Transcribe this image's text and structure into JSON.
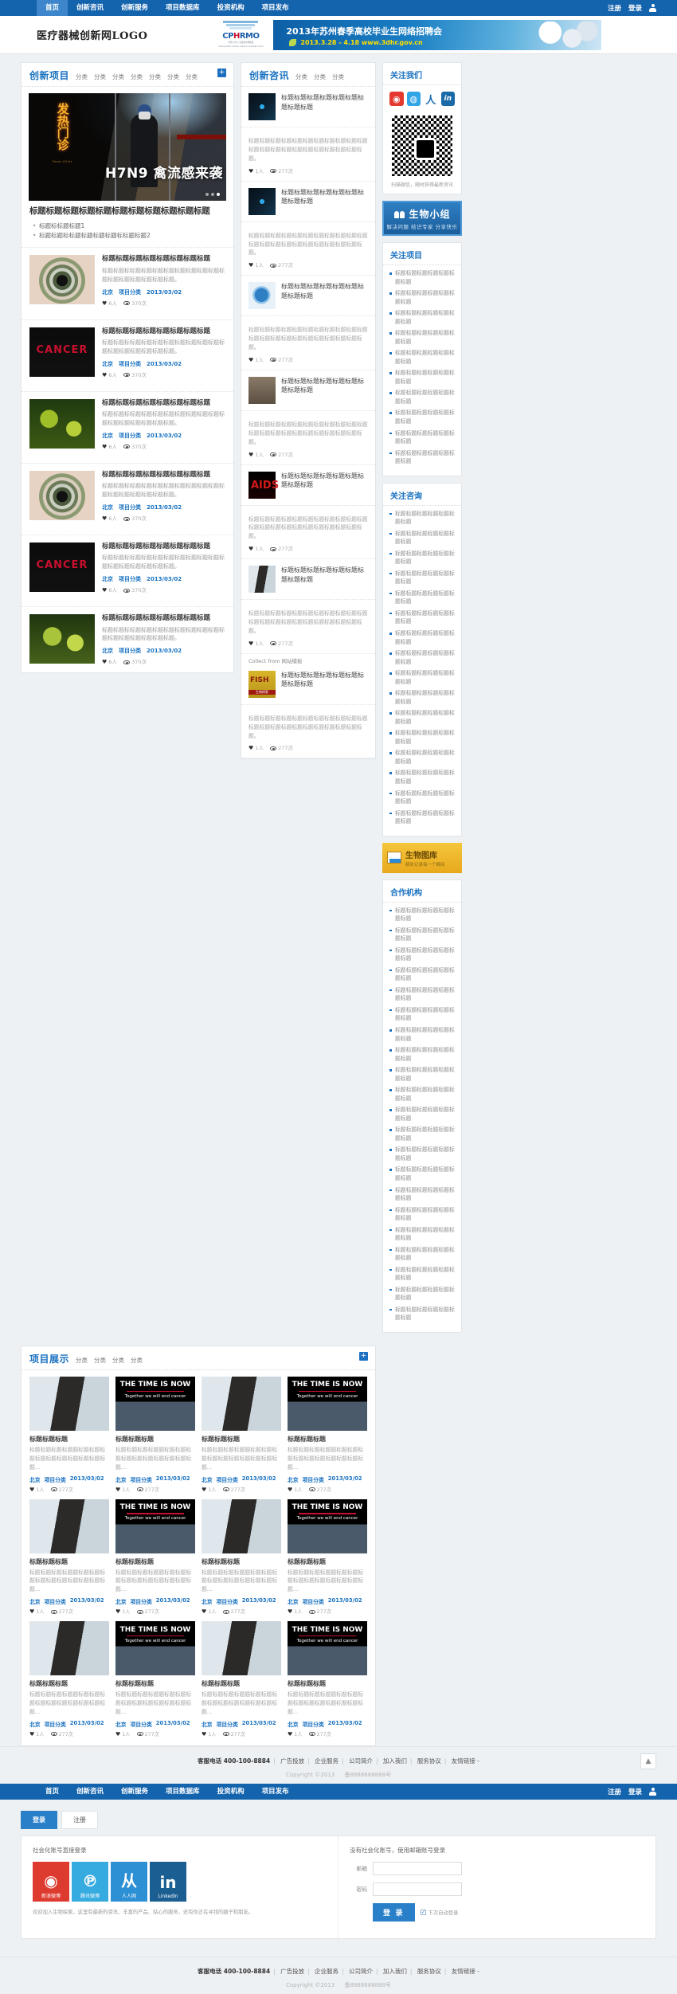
{
  "topnav": {
    "items": [
      "首页",
      "创新咨讯",
      "创新服务",
      "项目数据库",
      "投资机构",
      "项目发布"
    ],
    "active_index": 0,
    "register": "注册",
    "login": "登录"
  },
  "masthead": {
    "logo_text": "医疗器械创新网LOGO",
    "cphrmo": {
      "name_a": "CP",
      "name_b": "H",
      "name_c": "RMO",
      "sub1": "中国·公共人力资源市场联盟",
      "sub2": "China public human resource market union"
    },
    "banner": {
      "title": "2013年苏州春季高校毕业生网络招聘会",
      "subtitle": "2013.3.28 - 4.18 www.3dhr.gov.cn"
    }
  },
  "projects_section": {
    "title": "创新项目",
    "categories": [
      "分类",
      "分类",
      "分类",
      "分类",
      "分类",
      "分类",
      "分类"
    ],
    "plus": "+",
    "hero": {
      "sign_cn": "发热门诊",
      "sign_en": "Fever Clinic",
      "headline": "H7N9 禽流感来袭",
      "slide_count": 3,
      "active_slide": 2
    },
    "lead": {
      "title": "标题标题标题标题标题标题标题标题标题标题标题",
      "bullets": [
        "标题标标题标题1",
        "标题标题标标题标题标题标题标标题标题2"
      ]
    },
    "articles": [
      {
        "title": "标题标题标题标题标题标题标题标题",
        "desc": "标题标题标标题标题标题标题标题标题标题标题标题标题标题标题标题标题标题。",
        "loc": "北京",
        "cat": "项目分类",
        "date": "2013/03/02",
        "likes": "6人",
        "views": "370次",
        "thumb": "eye"
      },
      {
        "title": "标题标题标题标题标题标题标题标题",
        "desc": "标题标题标标题标题标题标题标题标题标题标题标题标题标题标题标题标题标题。",
        "loc": "北京",
        "cat": "项目分类",
        "date": "2013/03/02",
        "likes": "6人",
        "views": "370次",
        "thumb": "cancer"
      },
      {
        "title": "标题标题标题标题标题标题标题标题",
        "desc": "标题标题标标题标题标题标题标题标题标题标题标题标题标题标题标题标题标题。",
        "loc": "北京",
        "cat": "项目分类",
        "date": "2013/03/02",
        "likes": "6人",
        "views": "370次",
        "thumb": "green"
      },
      {
        "title": "标题标题标题标题标题标题标题标题",
        "desc": "标题标题标标题标题标题标题标题标题标题标题标题标题标题标题标题标题标题。",
        "loc": "北京",
        "cat": "项目分类",
        "date": "2013/03/02",
        "likes": "6人",
        "views": "370次",
        "thumb": "eye"
      },
      {
        "title": "标题标题标题标题标题标题标题标题",
        "desc": "标题标题标标题标题标题标题标题标题标题标题标题标题标题标题标题标题标题。",
        "loc": "北京",
        "cat": "项目分类",
        "date": "2013/03/02",
        "likes": "6人",
        "views": "370次",
        "thumb": "cancer2"
      },
      {
        "title": "标题标题标题标题标题标题标题标题",
        "desc": "标题标题标标题标题标题标题标题标题标题标题标题标题标题标题标题标题标题。",
        "loc": "北京",
        "cat": "项目分类",
        "date": "2013/03/02",
        "likes": "6人",
        "views": "370次",
        "thumb": "green2"
      }
    ]
  },
  "news_section": {
    "title": "创新咨讯",
    "categories": [
      "分类",
      "分类",
      "分类"
    ],
    "collect_note": "Collect from 网站模板",
    "items": [
      {
        "title": "标题标题标题标题标题标题标题标题标题",
        "desc": "标题标题标题标题标题标题标题标题标题标题标题标题标题标题标题标题标题标题标题标题标题标题。",
        "likes": "1人",
        "views": "277次",
        "thumb": "dna"
      },
      {
        "title": "标题标题标题标题标题标题标题标题标题",
        "desc": "标题标题标题标题标题标题标题标题标题标题标题标题标题标题标题标题标题标题标题标题标题标题。",
        "likes": "1人",
        "views": "277次",
        "thumb": "dna"
      },
      {
        "title": "标题标题标题标题标题标题标题标题标题",
        "desc": "标题标题标题标题标题标题标题标题标题标题标题标题标题标题标题标题标题标题标题标题标题标题。",
        "likes": "1人",
        "views": "277次",
        "thumb": "globe"
      },
      {
        "title": "标题标题标题标题标题标题标题标题标题",
        "desc": "标题标题标题标题标题标题标题标题标题标题标题标题标题标题标题标题标题标题标题标题标题标题。",
        "likes": "1人",
        "views": "277次",
        "thumb": "man"
      },
      {
        "title": "标题标题标题标题标题标题标题标题标题",
        "desc": "标题标题标题标题标题标题标题标题标题标题标题标题标题标题标题标题标题标题标题标题标题标题。",
        "likes": "1人",
        "views": "277次",
        "thumb": "aids"
      },
      {
        "title": "标题标题标题标题标题标题标题标题标题",
        "desc": "标题标题标题标题标题标题标题标题标题标题标题标题标题标题标题标题标题标题标题标题标题标题。",
        "likes": "1人",
        "views": "277次",
        "thumb": "lab"
      },
      {
        "title": "标题标题标题标题标题标题标题标题标题",
        "desc": "标题标题标题标题标题标题标题标题标题标题标题标题标题标题标题标题标题标题标题标题标题标题。",
        "likes": "1人",
        "views": "277次",
        "thumb": "fish"
      }
    ]
  },
  "sidebar": {
    "follow": {
      "title": "关注我们",
      "socials": [
        "weibo-icon",
        "qq-icon",
        "renren-icon",
        "linkedin-icon"
      ],
      "qr_caption": "扫描微信，随时获得最新资讯"
    },
    "group_banner": {
      "title": "生物小组",
      "subtitle": "解决问题  结识专家  分享快乐"
    },
    "watch_projects": {
      "title": "关注项目",
      "items": [
        "标题标题标题标题标题标题标题",
        "标题标题标题标题标题标题标题",
        "标题标题标题标题标题标题标题",
        "标题标题标题标题标题标题标题",
        "标题标题标题标题标题标题标题",
        "标题标题标题标题标题标题标题",
        "标题标题标题标题标题标题标题",
        "标题标题标题标题标题标题标题",
        "标题标题标题标题标题标题标题",
        "标题标题标题标题标题标题标题"
      ]
    },
    "watch_news": {
      "title": "关注咨询",
      "items": [
        "标题标题标题标题标题标题标题",
        "标题标题标题标题标题标题标题",
        "标题标题标题标题标题标题标题",
        "标题标题标题标题标题标题标题",
        "标题标题标题标题标题标题标题",
        "标题标题标题标题标题标题标题",
        "标题标题标题标题标题标题标题",
        "标题标题标题标题标题标题标题",
        "标题标题标题标题标题标题标题",
        "标题标题标题标题标题标题标题",
        "标题标题标题标题标题标题标题",
        "标题标题标题标题标题标题标题",
        "标题标题标题标题标题标题标题",
        "标题标题标题标题标题标题标题",
        "标题标题标题标题标题标题标题",
        "标题标题标题标题标题标题标题"
      ]
    },
    "library_banner": {
      "title": "生物图库",
      "subtitle": "精彩记录每一个瞬间"
    },
    "partners": {
      "title": "合作机构",
      "items": [
        "标题标题标题标题标题标题标题",
        "标题标题标题标题标题标题标题",
        "标题标题标题标题标题标题标题",
        "标题标题标题标题标题标题标题",
        "标题标题标题标题标题标题标题",
        "标题标题标题标题标题标题标题",
        "标题标题标题标题标题标题标题",
        "标题标题标题标题标题标题标题",
        "标题标题标题标题标题标题标题",
        "标题标题标题标题标题标题标题",
        "标题标题标题标题标题标题标题",
        "标题标题标题标题标题标题标题",
        "标题标题标题标题标题标题标题",
        "标题标题标题标题标题标题标题",
        "标题标题标题标题标题标题标题",
        "标题标题标题标题标题标题标题",
        "标题标题标题标题标题标题标题",
        "标题标题标题标题标题标题标题",
        "标题标题标题标题标题标题标题",
        "标题标题标题标题标题标题标题",
        "标题标题标题标题标题标题标题"
      ]
    }
  },
  "showcase": {
    "title": "项目展示",
    "categories": [
      "分类",
      "分类",
      "分类",
      "分类"
    ],
    "plus": "+",
    "cards": [
      {
        "title": "标题标题标题",
        "desc": "标题标题标题标题题标题标题标题标题标题标题标题标题标题标题...",
        "loc": "北京",
        "cat": "项目分类",
        "date": "2013/03/02",
        "likes": "1人",
        "views": "277次",
        "thumb": "lab"
      },
      {
        "title": "标题标题标题",
        "desc": "标题标题标题标题题标题标题标题标题标题标题标题标题标题标题...",
        "loc": "北京",
        "cat": "项目分类",
        "date": "2013/03/02",
        "likes": "1人",
        "views": "277次",
        "thumb": "time"
      },
      {
        "title": "标题标题标题",
        "desc": "标题标题标题标题题标题标题标题标题标题标题标题标题标题标题...",
        "loc": "北京",
        "cat": "项目分类",
        "date": "2013/03/02",
        "likes": "1人",
        "views": "277次",
        "thumb": "lab"
      },
      {
        "title": "标题标题标题",
        "desc": "标题标题标题标题题标题标题标题标题标题标题标题标题标题标题...",
        "loc": "北京",
        "cat": "项目分类",
        "date": "2013/03/02",
        "likes": "1人",
        "views": "277次",
        "thumb": "time"
      },
      {
        "title": "标题标题标题",
        "desc": "标题标题标题标题题标题标题标题标题标题标题标题标题标题标题...",
        "loc": "北京",
        "cat": "项目分类",
        "date": "2013/03/02",
        "likes": "1人",
        "views": "277次",
        "thumb": "lab"
      },
      {
        "title": "标题标题标题",
        "desc": "标题标题标题标题题标题标题标题标题标题标题标题标题标题标题...",
        "loc": "北京",
        "cat": "项目分类",
        "date": "2013/03/02",
        "likes": "1人",
        "views": "277次",
        "thumb": "time"
      },
      {
        "title": "标题标题标题",
        "desc": "标题标题标题标题题标题标题标题标题标题标题标题标题标题标题...",
        "loc": "北京",
        "cat": "项目分类",
        "date": "2013/03/02",
        "likes": "1人",
        "views": "277次",
        "thumb": "lab"
      },
      {
        "title": "标题标题标题",
        "desc": "标题标题标题标题题标题标题标题标题标题标题标题标题标题标题...",
        "loc": "北京",
        "cat": "项目分类",
        "date": "2013/03/02",
        "likes": "1人",
        "views": "277次",
        "thumb": "time"
      },
      {
        "title": "标题标题标题",
        "desc": "标题标题标题标题题标题标题标题标题标题标题标题标题标题标题...",
        "loc": "北京",
        "cat": "项目分类",
        "date": "2013/03/02",
        "likes": "1人",
        "views": "277次",
        "thumb": "lab"
      },
      {
        "title": "标题标题标题",
        "desc": "标题标题标题标题题标题标题标题标题标题标题标题标题标题标题...",
        "loc": "北京",
        "cat": "项目分类",
        "date": "2013/03/02",
        "likes": "1人",
        "views": "277次",
        "thumb": "time"
      },
      {
        "title": "标题标题标题",
        "desc": "标题标题标题标题题标题标题标题标题标题标题标题标题标题标题...",
        "loc": "北京",
        "cat": "项目分类",
        "date": "2013/03/02",
        "likes": "1人",
        "views": "277次",
        "thumb": "lab"
      },
      {
        "title": "标题标题标题",
        "desc": "标题标题标题标题题标题标题标题标题标题标题标题标题标题标题...",
        "loc": "北京",
        "cat": "项目分类",
        "date": "2013/03/02",
        "likes": "1人",
        "views": "277次",
        "thumb": "time"
      }
    ]
  },
  "footer": {
    "hotline": "客服电话 400-100-8884",
    "links": [
      "广告投放",
      "企业服务",
      "公司简介",
      "加入我们",
      "服务协议",
      "友情链接 -"
    ],
    "copyright": "Copyright ©2013",
    "icp": "备8888888888号",
    "gotop": "▲"
  },
  "login": {
    "tabs": [
      {
        "label": "登录",
        "active": true
      },
      {
        "label": "注册",
        "active": false
      }
    ],
    "social_heading": "社会化账号直接登录",
    "socials": [
      {
        "name": "新浪微博",
        "glyph": "◉"
      },
      {
        "name": "腾讯微博",
        "glyph": "℗"
      },
      {
        "name": "人人网",
        "glyph": "从"
      },
      {
        "name": "LinkedIn",
        "glyph": "in"
      }
    ],
    "note": "欢迎加入生物探索，这里有最新的资讯、丰富的产品、贴心的服务，还有你正在寻找的圈子和朋友。",
    "email_heading": "没有社会化账号，使用邮箱账号登录",
    "email_label": "邮箱",
    "email_value": "",
    "password_label": "密码",
    "password_value": "",
    "submit": "登 录",
    "remember": "下次自动登录"
  }
}
